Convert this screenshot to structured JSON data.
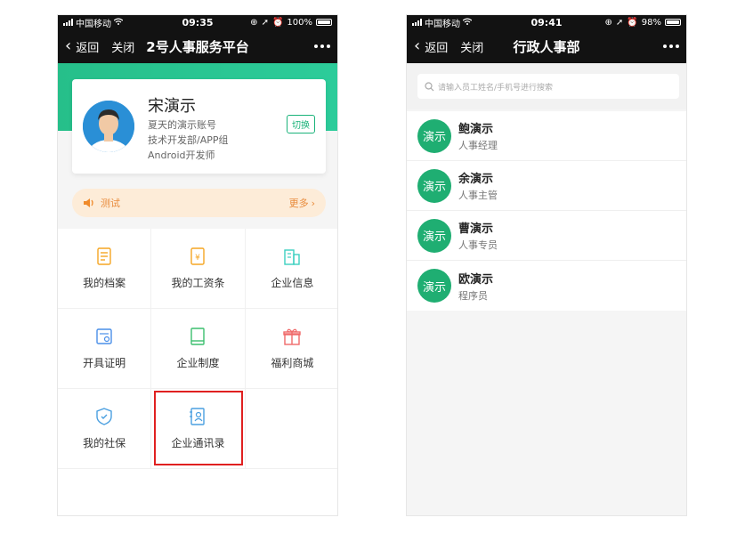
{
  "left": {
    "status": {
      "carrier": "中国移动",
      "time": "09:35",
      "battery": "100%",
      "battery_level": 1.0
    },
    "nav": {
      "back_label": "返回",
      "close_label": "关闭",
      "title": "2号人事服务平台"
    },
    "profile": {
      "name": "宋演示",
      "account": "夏天的演示账号",
      "department": "技术开发部/APP组",
      "position": "Android开发师",
      "switch_label": "切换"
    },
    "notice": {
      "text": "测试",
      "more_label": "更多"
    },
    "grid": [
      {
        "label": "我的档案",
        "icon": "archive-icon",
        "color": "#f5a623"
      },
      {
        "label": "我的工资条",
        "icon": "payslip-icon",
        "color": "#f5a623"
      },
      {
        "label": "企业信息",
        "icon": "building-icon",
        "color": "#3ccfc0"
      },
      {
        "label": "开具证明",
        "icon": "certificate-icon",
        "color": "#4a8fe8"
      },
      {
        "label": "企业制度",
        "icon": "book-icon",
        "color": "#3cbf6e"
      },
      {
        "label": "福利商城",
        "icon": "gift-icon",
        "color": "#f06a6a"
      },
      {
        "label": "我的社保",
        "icon": "shield-icon",
        "color": "#4a9fe0"
      },
      {
        "label": "企业通讯录",
        "icon": "contacts-book-icon",
        "color": "#4a9fe0"
      }
    ]
  },
  "right": {
    "status": {
      "carrier": "中国移动",
      "time": "09:41",
      "battery": "98%",
      "battery_level": 0.98
    },
    "nav": {
      "back_label": "返回",
      "close_label": "关闭",
      "title": "行政人事部"
    },
    "search": {
      "placeholder": "请输入员工姓名/手机号进行搜索"
    },
    "contacts": [
      {
        "avatar": "演示",
        "name": "鲍演示",
        "role": "人事经理"
      },
      {
        "avatar": "演示",
        "name": "余演示",
        "role": "人事主管"
      },
      {
        "avatar": "演示",
        "name": "曹演示",
        "role": "人事专员"
      },
      {
        "avatar": "演示",
        "name": "欧演示",
        "role": "程序员"
      }
    ]
  },
  "colors": {
    "accent_green": "#1fae72",
    "banner_green": "#26bf8a",
    "highlight_red": "#e02020",
    "notice_orange": "#e88a3a"
  }
}
